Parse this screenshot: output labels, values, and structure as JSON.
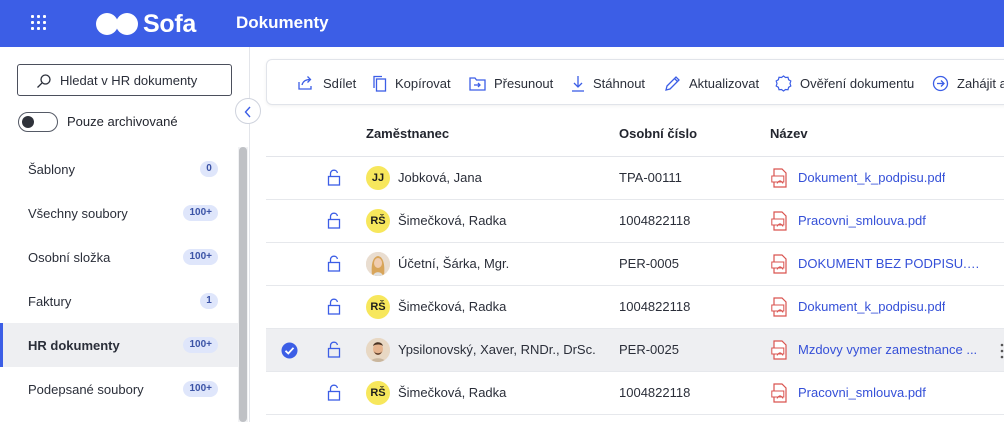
{
  "header": {
    "apps_icon": "grid-icon",
    "logo_text": "Sofa",
    "title": "Dokumenty",
    "color": "#3c5ee6"
  },
  "sidebar": {
    "search_placeholder": "Hledat v HR dokumenty",
    "archive_toggle_label": "Pouze archivované",
    "archive_toggle_on": false,
    "items": [
      {
        "label": "Šablony",
        "count": "0"
      },
      {
        "label": "Všechny soubory",
        "count": "100+"
      },
      {
        "label": "Osobní složka",
        "count": "100+"
      },
      {
        "label": "Faktury",
        "count": "1"
      },
      {
        "label": "HR dokumenty",
        "count": "100+",
        "active": true
      },
      {
        "label": "Podepsané soubory",
        "count": "100+"
      }
    ]
  },
  "toolbar": {
    "share": "Sdílet",
    "copy": "Kopírovat",
    "move": "Přesunout",
    "download": "Stáhnout",
    "update": "Aktualizovat",
    "verify": "Ověření dokumentu",
    "start": "Zahájit a"
  },
  "table": {
    "columns": [
      "Zaměstnanec",
      "Osobní číslo",
      "Název"
    ],
    "rows": [
      {
        "initials": "JJ",
        "name": "Jobková, Jana",
        "id": "TPA-00111",
        "file": "Dokument_k_podpisu.pdf",
        "selected": false,
        "avatar": "initials"
      },
      {
        "initials": "RŠ",
        "name": "Šimečková, Radka",
        "id": "1004822118",
        "file": "Pracovni_smlouva.pdf",
        "selected": false,
        "avatar": "initials"
      },
      {
        "initials": "",
        "name": "Účetní, Šárka, Mgr.",
        "id": "PER-0005",
        "file": "DOKUMENT BEZ PODPISU.PDF",
        "selected": false,
        "avatar": "photo-woman"
      },
      {
        "initials": "RŠ",
        "name": "Šimečková, Radka",
        "id": "1004822118",
        "file": "Dokument_k_podpisu.pdf",
        "selected": false,
        "avatar": "initials"
      },
      {
        "initials": "",
        "name": "Ypsilonovský, Xaver, RNDr., DrSc.",
        "id": "PER-0025",
        "file": "Mzdovy vymer zamestnance ...",
        "selected": true,
        "avatar": "photo-man"
      },
      {
        "initials": "RŠ",
        "name": "Šimečková, Radka",
        "id": "1004822118",
        "file": "Pracovni_smlouva.pdf",
        "selected": false,
        "avatar": "initials"
      }
    ]
  }
}
